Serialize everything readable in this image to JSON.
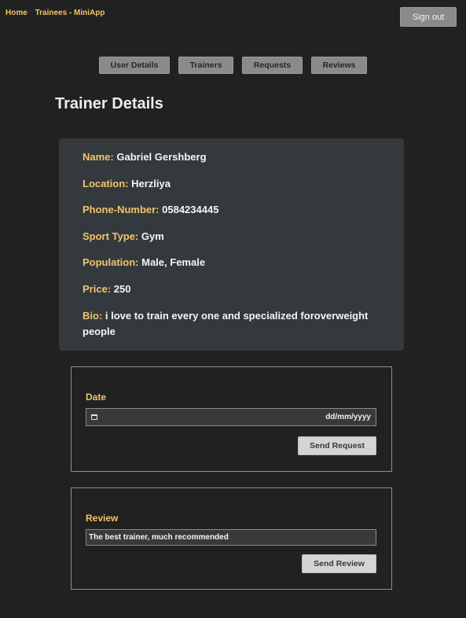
{
  "nav": {
    "home_label": "Home",
    "app_label": "Trainees - MiniApp",
    "signout_label": "Sign out"
  },
  "tabs": [
    {
      "label": "User Details"
    },
    {
      "label": "Trainers"
    },
    {
      "label": "Requests"
    },
    {
      "label": "Reviews"
    }
  ],
  "page": {
    "title": "Trainer Details"
  },
  "trainer": {
    "name_label": "Name:",
    "name": "Gabriel Gershberg",
    "location_label": "Location:",
    "location": "Herzliya",
    "phone_label": "Phone-Number:",
    "phone": "0584234445",
    "sport_label": "Sport Type:",
    "sport": "Gym",
    "population_label": "Population:",
    "population": "Male, Female",
    "price_label": "Price:",
    "price": "250",
    "bio_label": "Bio:",
    "bio": "i love to train every one and specialized foroverweight people"
  },
  "request_form": {
    "date_label": "Date",
    "date_placeholder": "dd/mm/yyyy",
    "calendar_icon": "calendar-icon",
    "submit_label": "Send Request"
  },
  "review_form": {
    "review_label": "Review",
    "review_value": "The best trainer, much recommended",
    "submit_label": "Send Review"
  },
  "colors": {
    "background": "#212121",
    "accent": "#f3c46b",
    "card": "#33393c",
    "button_gray": "#8a8a8a",
    "button_light": "#d4d4d4"
  }
}
